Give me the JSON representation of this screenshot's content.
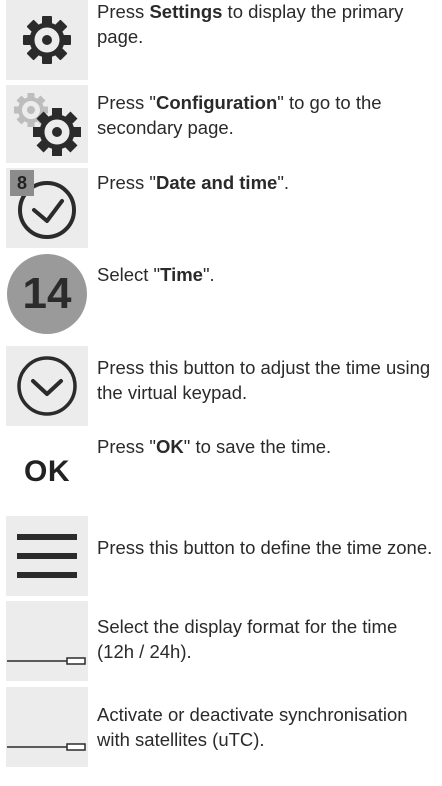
{
  "steps": [
    {
      "icon": "gear-icon",
      "parts": [
        "Press ",
        "Settings",
        " to display the primary page."
      ]
    },
    {
      "icon": "double-gear-icon",
      "parts": [
        "Press \"",
        "Configuration",
        "\" to go to the secondary page."
      ]
    },
    {
      "icon": "clock-icon",
      "badge": "8",
      "parts": [
        "Press \"",
        "Date and time",
        "\"."
      ]
    },
    {
      "icon": "number-badge-icon",
      "number": "14",
      "parts": [
        "Select \"",
        "Time",
        "\"."
      ]
    },
    {
      "icon": "chevron-down-circle-icon",
      "text": "Press this button to adjust the time using the virtual keypad."
    },
    {
      "icon": "ok-icon",
      "label": "OK",
      "parts": [
        "Press \"",
        "OK",
        "\" to save the time."
      ]
    },
    {
      "icon": "menu-icon",
      "text": "Press this button to define the time zone."
    },
    {
      "icon": "toggle-icon",
      "text": "Select the display format for the time (12h / 24h)."
    },
    {
      "icon": "toggle-icon",
      "text": "Activate or deactivate synchronisation with satellites (uTC)."
    }
  ]
}
